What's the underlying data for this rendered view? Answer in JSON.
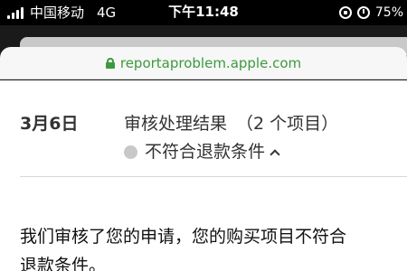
{
  "status_bar": {
    "carrier": "中国移动",
    "network": "4G",
    "time": "下午11:48",
    "battery": "75%",
    "icons": [
      "signal-bars-icon",
      "rotation-lock-icon",
      "alarm-icon"
    ]
  },
  "browser": {
    "url": "reportaproblem.apple.com",
    "url_color": "#3c9a3c",
    "secure_icon": "lock-icon"
  },
  "order": {
    "date": "3月6日",
    "title": "审核处理结果",
    "item_count": "（2 个项目）",
    "status": "不符合退款条件",
    "status_dot_color": "#c8c8c8"
  },
  "message": {
    "line1": "我们审核了您的申请，您的购买项目不符合",
    "line2": "退款条件。"
  }
}
